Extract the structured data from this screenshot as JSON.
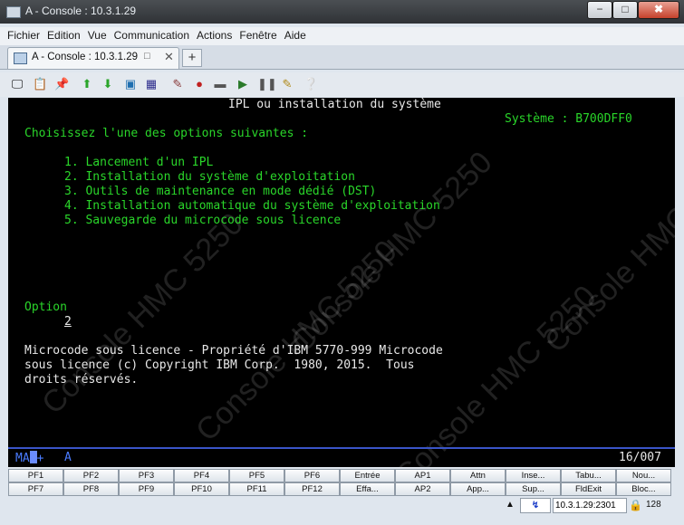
{
  "window": {
    "title": "A - Console : 10.3.1.29",
    "minimize": "−",
    "maximize": "□",
    "close": "✖"
  },
  "menu": [
    "Fichier",
    "Edition",
    "Vue",
    "Communication",
    "Actions",
    "Fenêtre",
    "Aide"
  ],
  "tab": {
    "label": "A - Console : 10.3.1.29",
    "close": "✕",
    "new_tab": "+"
  },
  "toolbar_icons": [
    "copy-icon",
    "paste-icon",
    "clipboard-icon",
    "send-icon",
    "receive-icon",
    "display-icon",
    "keypad-icon",
    "macro-record-icon",
    "stop-icon",
    "disconnect-icon",
    "play-icon",
    "pause-icon",
    "notes-icon",
    "help-icon"
  ],
  "terminal": {
    "header_title": "IPL ou installation du système",
    "system_label": "Système : B700DFF0",
    "instruction": "Choisissez l'une des options suivantes :",
    "options": [
      "1. Lancement d'un IPL",
      "2. Installation du système d'exploitation",
      "3. Outils de maintenance en mode dédié (DST)",
      "4. Installation automatique du système d'exploitation",
      "5. Sauvegarde du microcode sous licence"
    ],
    "option_label": "Option",
    "option_value": "2",
    "copyright": [
      "Microcode sous licence - Propriété d'IBM 5770-999 Microcode",
      "sous licence (c) Copyright IBM Corp.  1980, 2015.  Tous",
      "droits réservés."
    ],
    "watermark": "Console HMC 5250",
    "status_left": "MA",
    "status_plus": "+",
    "status_mode": "A",
    "status_position": "16/007"
  },
  "keys_row1": [
    "PF1",
    "PF2",
    "PF3",
    "PF4",
    "PF5",
    "PF6",
    "Entrée",
    "AP1",
    "Attn",
    "Inse...",
    "Tabu...",
    "Nou..."
  ],
  "keys_row2": [
    "PF7",
    "PF8",
    "PF9",
    "PF10",
    "PF11",
    "PF12",
    "Effa...",
    "AP2",
    "App...",
    "Sup...",
    "FldExit",
    "Bloc..."
  ],
  "statusbar": {
    "host": "10.3.1.29:2301",
    "lock_number": "128"
  },
  "colors": {
    "terminal_bg": "#000000",
    "terminal_green": "#2ad62a",
    "terminal_white": "#e8e8e8",
    "status_blue": "#3a55c8"
  }
}
